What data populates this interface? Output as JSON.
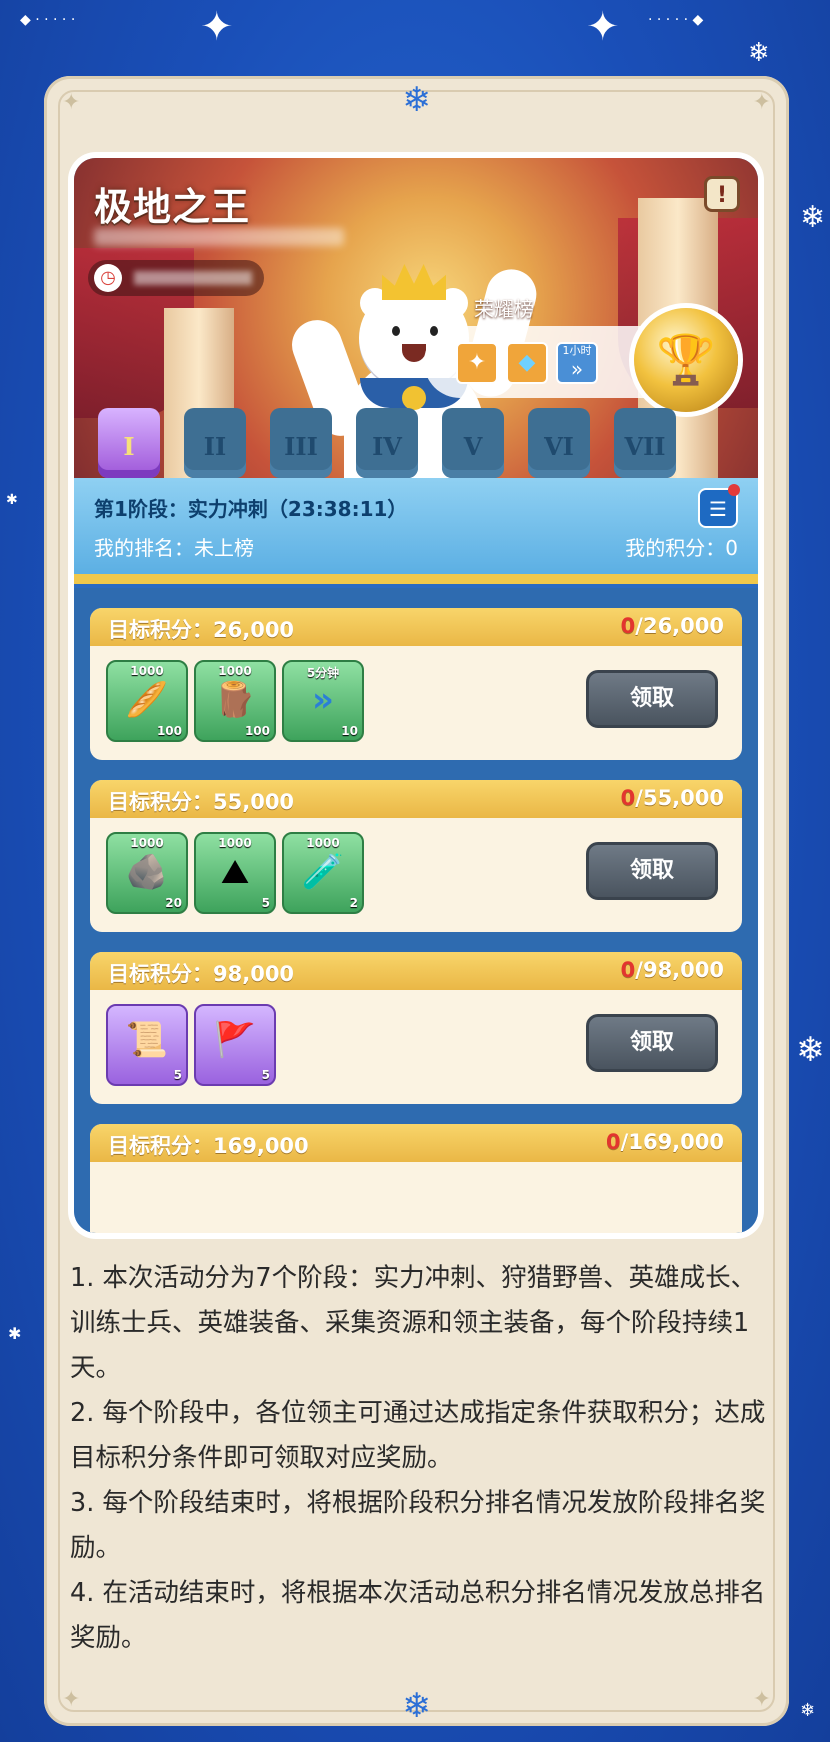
{
  "event": {
    "title": "极地之王",
    "info_icon": "exclamation-icon",
    "timer_icon": "clock-icon"
  },
  "honor": {
    "label": "荣耀榜",
    "items": [
      {
        "icon": "puzzle-icon",
        "glyph": "✦",
        "color": "#f0a53a"
      },
      {
        "icon": "diamond-icon",
        "glyph": "◆",
        "color": "#f0a53a"
      },
      {
        "icon": "speedup-hour-icon",
        "glyph": "»",
        "badge": "1小时",
        "color": "#4a8fd6"
      }
    ],
    "trophy_icon": "trophy-icon"
  },
  "stages": [
    "I",
    "II",
    "III",
    "IV",
    "V",
    "VI",
    "VII"
  ],
  "phase": {
    "title": "第1阶段：实力冲刺（23:38:11）",
    "my_rank": "我的排名：未上榜",
    "my_score": "我的积分：0",
    "log_icon": "log-icon"
  },
  "rewards": [
    {
      "target": "目标积分：26,000",
      "current": "0",
      "goal": "/26,000",
      "items": [
        {
          "name": "bread-icon",
          "glyph": "🥖",
          "amount": "1000",
          "qty": "100",
          "style": "green"
        },
        {
          "name": "wood-icon",
          "glyph": "🪵",
          "amount": "1000",
          "qty": "100",
          "style": "green"
        },
        {
          "name": "speedup-icon",
          "glyph": "»",
          "amount": "5分钟",
          "qty": "10",
          "style": "green"
        }
      ],
      "claim": "领取"
    },
    {
      "target": "目标积分：55,000",
      "current": "0",
      "goal": "/55,000",
      "items": [
        {
          "name": "stone-icon",
          "glyph": "🪨",
          "amount": "1000",
          "qty": "20",
          "style": "green"
        },
        {
          "name": "iron-ore-icon",
          "glyph": "⛰",
          "amount": "1000",
          "qty": "5",
          "style": "green"
        },
        {
          "name": "potion-icon",
          "glyph": "🧪",
          "amount": "1000",
          "qty": "2",
          "style": "green"
        }
      ],
      "claim": "领取"
    },
    {
      "target": "目标积分：98,000",
      "current": "0",
      "goal": "/98,000",
      "items": [
        {
          "name": "purple-scroll-icon",
          "glyph": "📜",
          "amount": "",
          "qty": "5",
          "style": "purple"
        },
        {
          "name": "purple-flag-scroll-icon",
          "glyph": "🚩",
          "amount": "",
          "qty": "5",
          "style": "purple"
        }
      ],
      "claim": "领取"
    },
    {
      "target": "目标积分：169,000",
      "current": "0",
      "goal": "/169,000",
      "items": [],
      "claim": ""
    }
  ],
  "rules": [
    "1. 本次活动分为7个阶段：实力冲刺、狩猎野兽、英雄成长、训练士兵、英雄装备、采集资源和领主装备，每个阶段持续1天。",
    "2. 每个阶段中，各位领主可通过达成指定条件获取积分；达成目标积分条件即可领取对应奖励。",
    "3. 每个阶段结束时，将根据阶段积分排名情况发放阶段排名奖励。",
    "4. 在活动结束时，将根据本次活动总积分排名情况发放总排名奖励。"
  ],
  "colors": {
    "background": "#1a4fb8",
    "card": "#efe6d4",
    "gold": "#eab746",
    "progress_current": "#e2352f"
  }
}
